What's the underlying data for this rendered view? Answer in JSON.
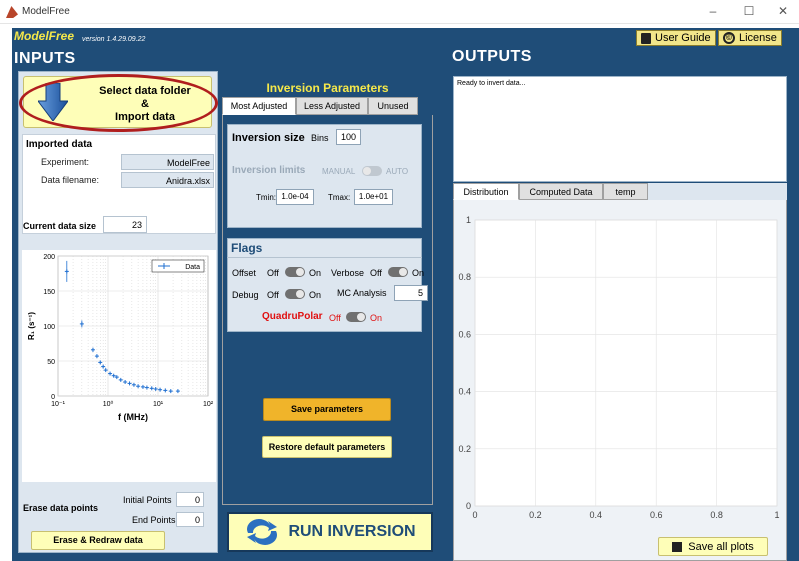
{
  "window": {
    "title": "ModelFree",
    "minimize": "–",
    "maximize": "☐",
    "close": "✕"
  },
  "header": {
    "brand": "ModelFree",
    "version": "version 1.4.29.09.22",
    "user_guide": "User Guide",
    "license": "License",
    "license_icon": "©"
  },
  "inputs": {
    "title": "INPUTS",
    "select_button": {
      "line1": "Select data folder",
      "line2": "&",
      "line3": "Import data",
      "icon": "down-arrow-icon"
    },
    "imported": {
      "heading": "Imported data",
      "experiment_label": "Experiment:",
      "experiment_value": "ModelFree",
      "filename_label": "Data filename:",
      "filename_value": "Anidra.xlsx"
    },
    "current_size_label": "Current data size",
    "current_size_value": "23",
    "erase": {
      "label": "Erase data points",
      "initial_label": "Initial Points",
      "initial_value": "0",
      "end_label": "End Points",
      "end_value": "0",
      "button": "Erase & Redraw data"
    }
  },
  "inversion": {
    "title": "Inversion Parameters",
    "tabs": [
      "Most Adjusted",
      "Less Adjusted",
      "Unused"
    ],
    "size_label": "Inversion size",
    "bins_label": "Bins",
    "bins_value": "100",
    "limits_label": "Inversion limits",
    "manual_label": "MANUAL",
    "auto_label": "AUTO",
    "tmin_label": "Tmin:",
    "tmin_value": "1.0e-04",
    "tmax_label": "Tmax:",
    "tmax_value": "1.0e+01",
    "flags": {
      "title": "Flags",
      "offset_label": "Offset",
      "verbose_label": "Verbose",
      "debug_label": "Debug",
      "mc_label": "MC Analysis",
      "mc_value": "5",
      "quadrupolar_label": "QuadruPolar",
      "off": "Off",
      "on": "On"
    },
    "save_button": "Save parameters",
    "restore_button": "Restore default parameters",
    "run_button": "RUN INVERSION"
  },
  "outputs": {
    "title": "OUTPUTS",
    "log_text": "Ready to invert data...",
    "tabs": [
      "Distribution",
      "Computed Data",
      "temp"
    ],
    "save_all": "Save all plots"
  },
  "colors": {
    "panel_bg": "#1f4d78",
    "accent_yellow": "#f5e84a",
    "button_yellow": "#fefeb8",
    "save_orange": "#f0b42a",
    "data_blue": "#1f6fd1",
    "quadrupolar_red": "#e01010"
  },
  "chart_data": [
    {
      "type": "scatter",
      "title": "",
      "xlabel": "f  (MHz)",
      "ylabel": "R₁ (s⁻¹)",
      "x_scale": "log",
      "xlim": [
        0.1,
        100
      ],
      "ylim": [
        0,
        200
      ],
      "x_ticks": [
        "10⁻¹",
        "10⁰",
        "10¹",
        "10²"
      ],
      "y_ticks": [
        "0",
        "50",
        "100",
        "150",
        "200"
      ],
      "legend": "top-right",
      "grid": true,
      "series": [
        {
          "name": "Data",
          "x": [
            0.15,
            0.3,
            0.5,
            0.6,
            0.7,
            0.8,
            0.9,
            1.1,
            1.3,
            1.5,
            1.8,
            2.2,
            2.7,
            3.3,
            4.0,
            5.0,
            6.0,
            7.5,
            9.0,
            11.0,
            14.0,
            18.0,
            25.0
          ],
          "y": [
            178,
            103,
            66,
            57,
            48,
            42,
            37,
            32,
            29,
            27,
            23,
            20,
            18,
            16,
            14,
            13,
            12,
            11,
            10,
            9,
            8,
            7,
            7
          ],
          "err": [
            15,
            5,
            3,
            2,
            2,
            2,
            1,
            1,
            1,
            1,
            1,
            1,
            1,
            1,
            1,
            1,
            1,
            1,
            1,
            1,
            1,
            1,
            1
          ]
        }
      ]
    },
    {
      "type": "line",
      "title": "",
      "xlabel": "",
      "ylabel": "",
      "xlim": [
        0,
        1
      ],
      "ylim": [
        0,
        1
      ],
      "x_ticks": [
        "0",
        "0.2",
        "0.4",
        "0.6",
        "0.8",
        "1"
      ],
      "y_ticks": [
        "0",
        "0.2",
        "0.4",
        "0.6",
        "0.8",
        "1"
      ],
      "grid": true,
      "series": []
    }
  ]
}
